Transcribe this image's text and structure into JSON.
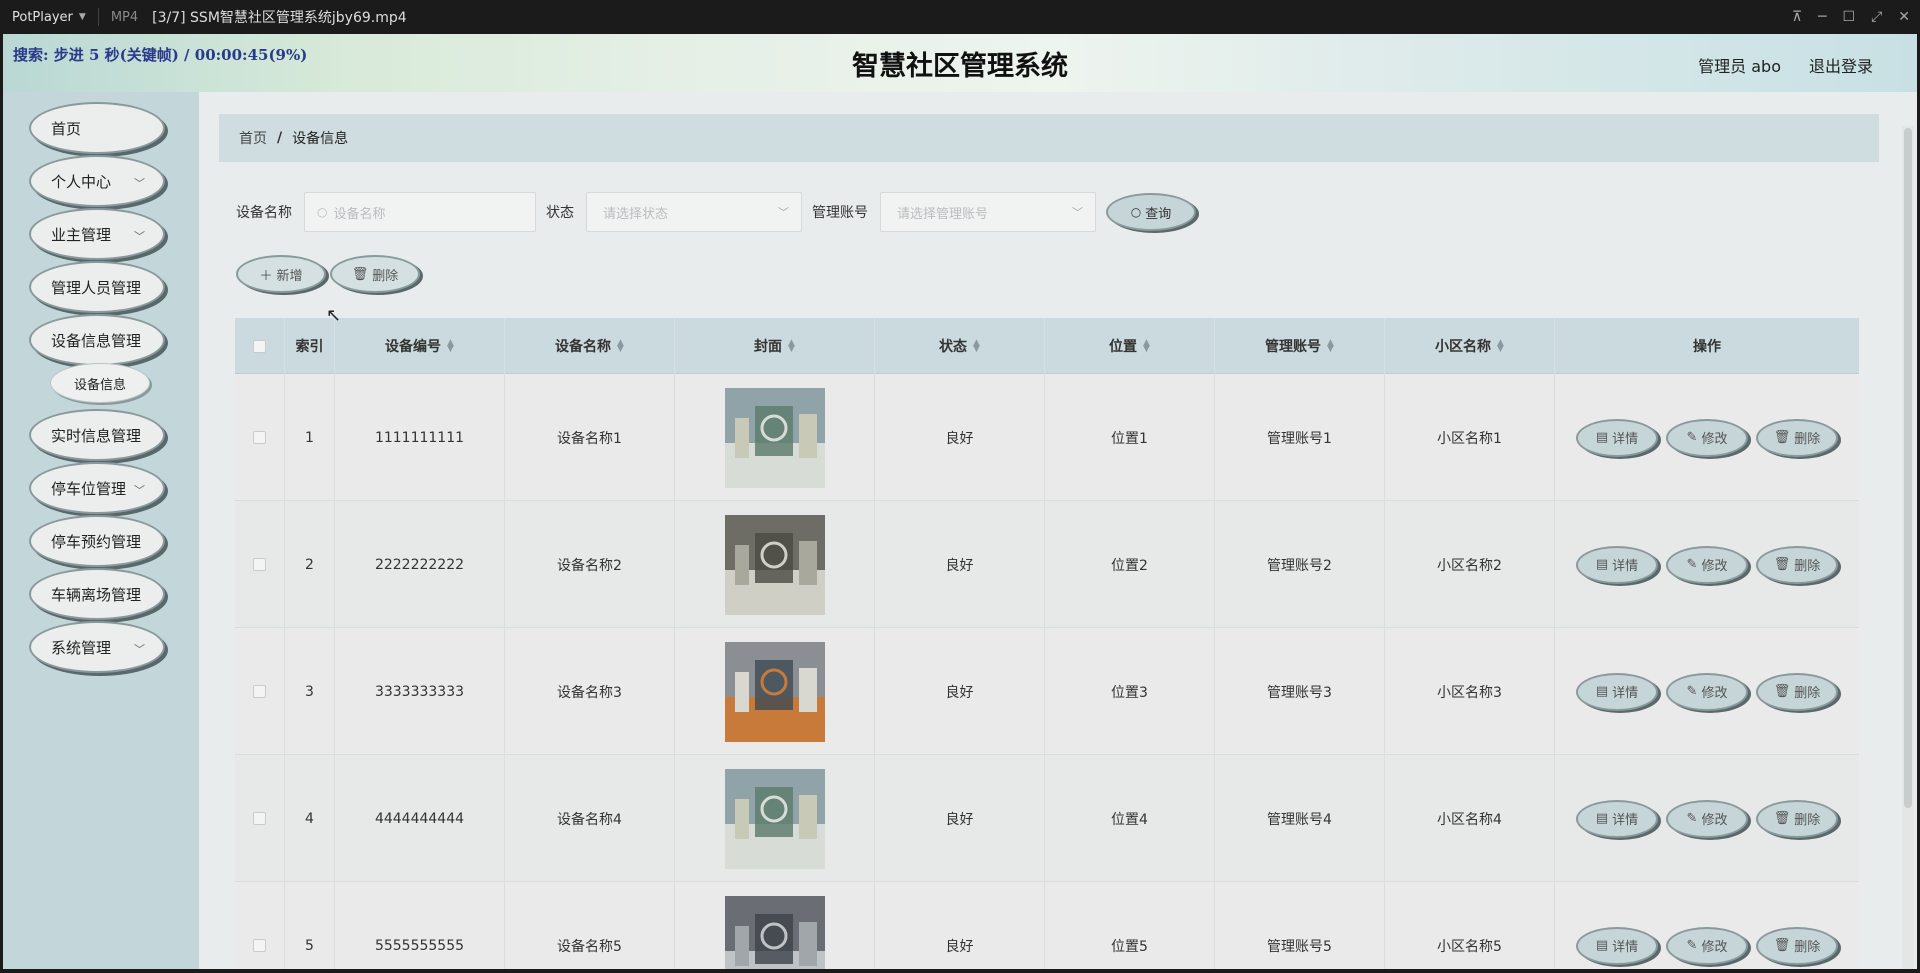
{
  "player": {
    "name": "PotPlayer",
    "format": "MP4",
    "file": "[3/7] SSM智慧社区管理系统jby69.mp4",
    "osd": "搜索: 步进 5 秒(关键帧) / 00:00:45(9%)"
  },
  "header": {
    "title": "智慧社区管理系统",
    "user": "管理员 abo",
    "logout": "退出登录"
  },
  "sidebar": {
    "items": [
      {
        "label": "首页",
        "has_arrow": false
      },
      {
        "label": "个人中心",
        "has_arrow": true
      },
      {
        "label": "业主管理",
        "has_arrow": true
      },
      {
        "label": "管理人员管理",
        "has_arrow": false
      },
      {
        "label": "设备信息管理",
        "has_arrow": false
      },
      {
        "label": "实时信息管理",
        "has_arrow": false
      },
      {
        "label": "停车位管理",
        "has_arrow": true
      },
      {
        "label": "停车预约管理",
        "has_arrow": false
      },
      {
        "label": "车辆离场管理",
        "has_arrow": false
      },
      {
        "label": "系统管理",
        "has_arrow": true
      }
    ],
    "sub_item": "设备信息"
  },
  "breadcrumb": {
    "home": "首页",
    "current": "设备信息"
  },
  "search": {
    "name_label": "设备名称",
    "name_placeholder": "设备名称",
    "status_label": "状态",
    "status_placeholder": "请选择状态",
    "account_label": "管理账号",
    "account_placeholder": "请选择管理账号",
    "query_button": "查询"
  },
  "toolbar": {
    "add": "新增",
    "delete": "删除"
  },
  "table": {
    "columns": [
      "索引",
      "设备编号",
      "设备名称",
      "封面",
      "状态",
      "位置",
      "管理账号",
      "小区名称",
      "操作"
    ],
    "rows": [
      {
        "index": "1",
        "code": "1111111111",
        "name": "设备名称1",
        "status": "良好",
        "location": "位置1",
        "account": "管理账号1",
        "community": "小区名称1"
      },
      {
        "index": "2",
        "code": "2222222222",
        "name": "设备名称2",
        "status": "良好",
        "location": "位置2",
        "account": "管理账号2",
        "community": "小区名称2"
      },
      {
        "index": "3",
        "code": "3333333333",
        "name": "设备名称3",
        "status": "良好",
        "location": "位置3",
        "account": "管理账号3",
        "community": "小区名称3"
      },
      {
        "index": "4",
        "code": "4444444444",
        "name": "设备名称4",
        "status": "良好",
        "location": "位置4",
        "account": "管理账号4",
        "community": "小区名称4"
      },
      {
        "index": "5",
        "code": "5555555555",
        "name": "设备名称5",
        "status": "良好",
        "location": "位置5",
        "account": "管理账号5",
        "community": "小区名称5"
      }
    ],
    "row_actions": {
      "detail": "详情",
      "edit": "修改",
      "delete": "删除"
    }
  },
  "colors": {
    "sidebar_bg": "#c3d6da",
    "header_bar_bg": "#cbdade",
    "button_bg": "#c6d5d8"
  }
}
